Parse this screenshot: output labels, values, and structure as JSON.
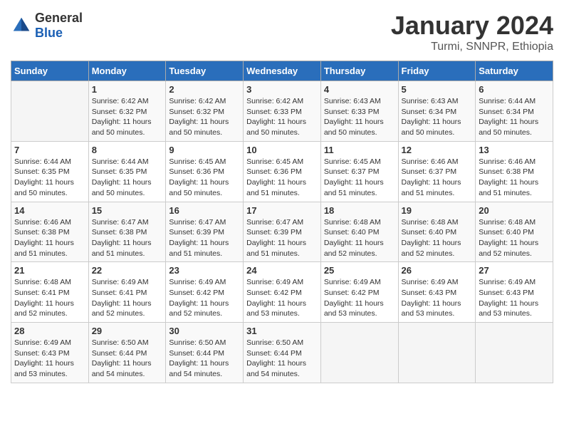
{
  "logo": {
    "general": "General",
    "blue": "Blue"
  },
  "title": "January 2024",
  "subtitle": "Turmi, SNNPR, Ethiopia",
  "days_header": [
    "Sunday",
    "Monday",
    "Tuesday",
    "Wednesday",
    "Thursday",
    "Friday",
    "Saturday"
  ],
  "weeks": [
    [
      {
        "day": "",
        "info": ""
      },
      {
        "day": "1",
        "info": "Sunrise: 6:42 AM\nSunset: 6:32 PM\nDaylight: 11 hours\nand 50 minutes."
      },
      {
        "day": "2",
        "info": "Sunrise: 6:42 AM\nSunset: 6:32 PM\nDaylight: 11 hours\nand 50 minutes."
      },
      {
        "day": "3",
        "info": "Sunrise: 6:42 AM\nSunset: 6:33 PM\nDaylight: 11 hours\nand 50 minutes."
      },
      {
        "day": "4",
        "info": "Sunrise: 6:43 AM\nSunset: 6:33 PM\nDaylight: 11 hours\nand 50 minutes."
      },
      {
        "day": "5",
        "info": "Sunrise: 6:43 AM\nSunset: 6:34 PM\nDaylight: 11 hours\nand 50 minutes."
      },
      {
        "day": "6",
        "info": "Sunrise: 6:44 AM\nSunset: 6:34 PM\nDaylight: 11 hours\nand 50 minutes."
      }
    ],
    [
      {
        "day": "7",
        "info": "Sunrise: 6:44 AM\nSunset: 6:35 PM\nDaylight: 11 hours\nand 50 minutes."
      },
      {
        "day": "8",
        "info": "Sunrise: 6:44 AM\nSunset: 6:35 PM\nDaylight: 11 hours\nand 50 minutes."
      },
      {
        "day": "9",
        "info": "Sunrise: 6:45 AM\nSunset: 6:36 PM\nDaylight: 11 hours\nand 50 minutes."
      },
      {
        "day": "10",
        "info": "Sunrise: 6:45 AM\nSunset: 6:36 PM\nDaylight: 11 hours\nand 51 minutes."
      },
      {
        "day": "11",
        "info": "Sunrise: 6:45 AM\nSunset: 6:37 PM\nDaylight: 11 hours\nand 51 minutes."
      },
      {
        "day": "12",
        "info": "Sunrise: 6:46 AM\nSunset: 6:37 PM\nDaylight: 11 hours\nand 51 minutes."
      },
      {
        "day": "13",
        "info": "Sunrise: 6:46 AM\nSunset: 6:38 PM\nDaylight: 11 hours\nand 51 minutes."
      }
    ],
    [
      {
        "day": "14",
        "info": "Sunrise: 6:46 AM\nSunset: 6:38 PM\nDaylight: 11 hours\nand 51 minutes."
      },
      {
        "day": "15",
        "info": "Sunrise: 6:47 AM\nSunset: 6:38 PM\nDaylight: 11 hours\nand 51 minutes."
      },
      {
        "day": "16",
        "info": "Sunrise: 6:47 AM\nSunset: 6:39 PM\nDaylight: 11 hours\nand 51 minutes."
      },
      {
        "day": "17",
        "info": "Sunrise: 6:47 AM\nSunset: 6:39 PM\nDaylight: 11 hours\nand 51 minutes."
      },
      {
        "day": "18",
        "info": "Sunrise: 6:48 AM\nSunset: 6:40 PM\nDaylight: 11 hours\nand 52 minutes."
      },
      {
        "day": "19",
        "info": "Sunrise: 6:48 AM\nSunset: 6:40 PM\nDaylight: 11 hours\nand 52 minutes."
      },
      {
        "day": "20",
        "info": "Sunrise: 6:48 AM\nSunset: 6:40 PM\nDaylight: 11 hours\nand 52 minutes."
      }
    ],
    [
      {
        "day": "21",
        "info": "Sunrise: 6:48 AM\nSunset: 6:41 PM\nDaylight: 11 hours\nand 52 minutes."
      },
      {
        "day": "22",
        "info": "Sunrise: 6:49 AM\nSunset: 6:41 PM\nDaylight: 11 hours\nand 52 minutes."
      },
      {
        "day": "23",
        "info": "Sunrise: 6:49 AM\nSunset: 6:42 PM\nDaylight: 11 hours\nand 52 minutes."
      },
      {
        "day": "24",
        "info": "Sunrise: 6:49 AM\nSunset: 6:42 PM\nDaylight: 11 hours\nand 53 minutes."
      },
      {
        "day": "25",
        "info": "Sunrise: 6:49 AM\nSunset: 6:42 PM\nDaylight: 11 hours\nand 53 minutes."
      },
      {
        "day": "26",
        "info": "Sunrise: 6:49 AM\nSunset: 6:43 PM\nDaylight: 11 hours\nand 53 minutes."
      },
      {
        "day": "27",
        "info": "Sunrise: 6:49 AM\nSunset: 6:43 PM\nDaylight: 11 hours\nand 53 minutes."
      }
    ],
    [
      {
        "day": "28",
        "info": "Sunrise: 6:49 AM\nSunset: 6:43 PM\nDaylight: 11 hours\nand 53 minutes."
      },
      {
        "day": "29",
        "info": "Sunrise: 6:50 AM\nSunset: 6:44 PM\nDaylight: 11 hours\nand 54 minutes."
      },
      {
        "day": "30",
        "info": "Sunrise: 6:50 AM\nSunset: 6:44 PM\nDaylight: 11 hours\nand 54 minutes."
      },
      {
        "day": "31",
        "info": "Sunrise: 6:50 AM\nSunset: 6:44 PM\nDaylight: 11 hours\nand 54 minutes."
      },
      {
        "day": "",
        "info": ""
      },
      {
        "day": "",
        "info": ""
      },
      {
        "day": "",
        "info": ""
      }
    ]
  ]
}
